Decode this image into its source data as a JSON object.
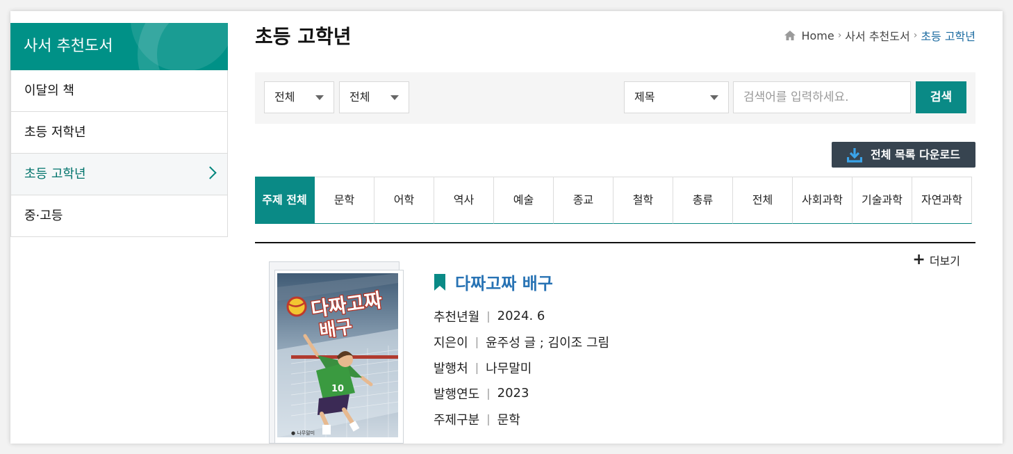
{
  "sidebar": {
    "title": "사서 추천도서",
    "items": [
      {
        "label": "이달의 책"
      },
      {
        "label": "초등 저학년"
      },
      {
        "label": "초등 고학년"
      },
      {
        "label": "중·고등"
      }
    ]
  },
  "page": {
    "title": "초등 고학년"
  },
  "breadcrumb": {
    "home": "Home",
    "parent": "사서 추천도서",
    "current": "초등 고학년"
  },
  "search": {
    "filter1": "전체",
    "filter2": "전체",
    "field": "제목",
    "placeholder": "검색어를 입력하세요.",
    "button": "검색"
  },
  "download_button": "전체 목록 다운로드",
  "tabs": [
    "주제 전체",
    "문학",
    "어학",
    "역사",
    "예술",
    "종교",
    "철학",
    "총류",
    "전체",
    "사회과학",
    "기술과학",
    "자연과학"
  ],
  "more_label": "더보기",
  "book": {
    "title": "다짜고짜 배구",
    "cover_text": "다짜고짜 배구",
    "meta": [
      {
        "label": "추천년월",
        "value": "2024. 6"
      },
      {
        "label": "지은이",
        "value": "윤주성 글 ; 김이조 그림"
      },
      {
        "label": "발행처",
        "value": "나무말미"
      },
      {
        "label": "발행연도",
        "value": "2023"
      },
      {
        "label": "주제구분",
        "value": "문학"
      }
    ]
  },
  "colors": {
    "teal": "#009187",
    "link_blue": "#2873b4",
    "dark_button": "#374450"
  }
}
